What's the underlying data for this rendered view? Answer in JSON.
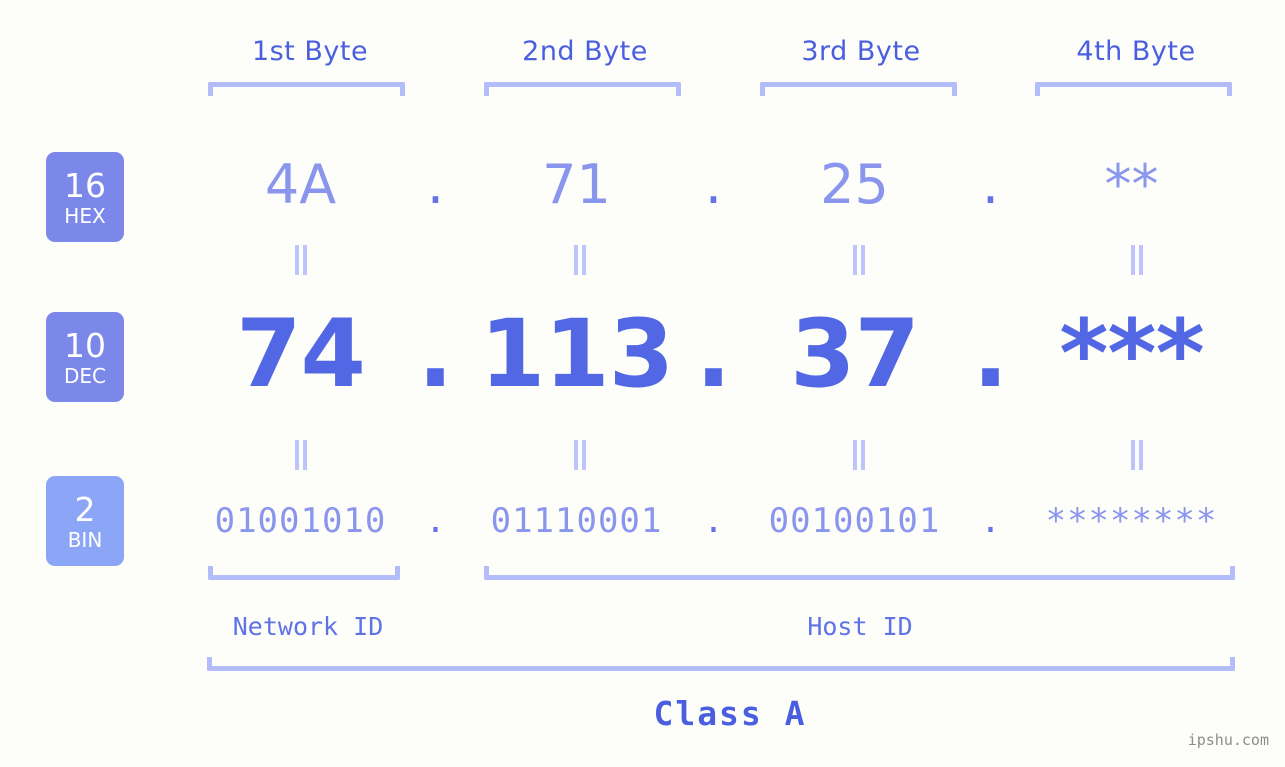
{
  "watermark": "ipshu.com",
  "byte_headers": [
    {
      "label": "1st Byte"
    },
    {
      "label": "2nd Byte"
    },
    {
      "label": "3rd Byte"
    },
    {
      "label": "4th Byte"
    }
  ],
  "radix_badges": [
    {
      "number": "16",
      "name": "HEX",
      "color": "#7b88ea"
    },
    {
      "number": "10",
      "name": "DEC",
      "color": "#7b88ea"
    },
    {
      "number": "2",
      "name": "BIN",
      "color": "#8ba6f6"
    }
  ],
  "separator": ".",
  "rows": {
    "hex": {
      "values": [
        "4A",
        "71",
        "25",
        "**"
      ]
    },
    "dec": {
      "values": [
        "74",
        "113",
        "37",
        "***"
      ]
    },
    "bin": {
      "values": [
        "01001010",
        "01110001",
        "00100101",
        "********"
      ]
    }
  },
  "sections": {
    "network_id": "Network ID",
    "host_id": "Host ID",
    "class": "Class A"
  },
  "colors": {
    "background": "#fdfdfa",
    "header_text": "#4a5fe0",
    "bracket": "#b4bdfb",
    "hex_text": "#8a95ed",
    "dec_text": "#5167e4",
    "bin_text": "#8a95ed",
    "connector": "#bcc4fb",
    "badge_primary": "#7b88ea",
    "badge_bin": "#8ba6f6",
    "watermark": "#8d8d8d"
  }
}
